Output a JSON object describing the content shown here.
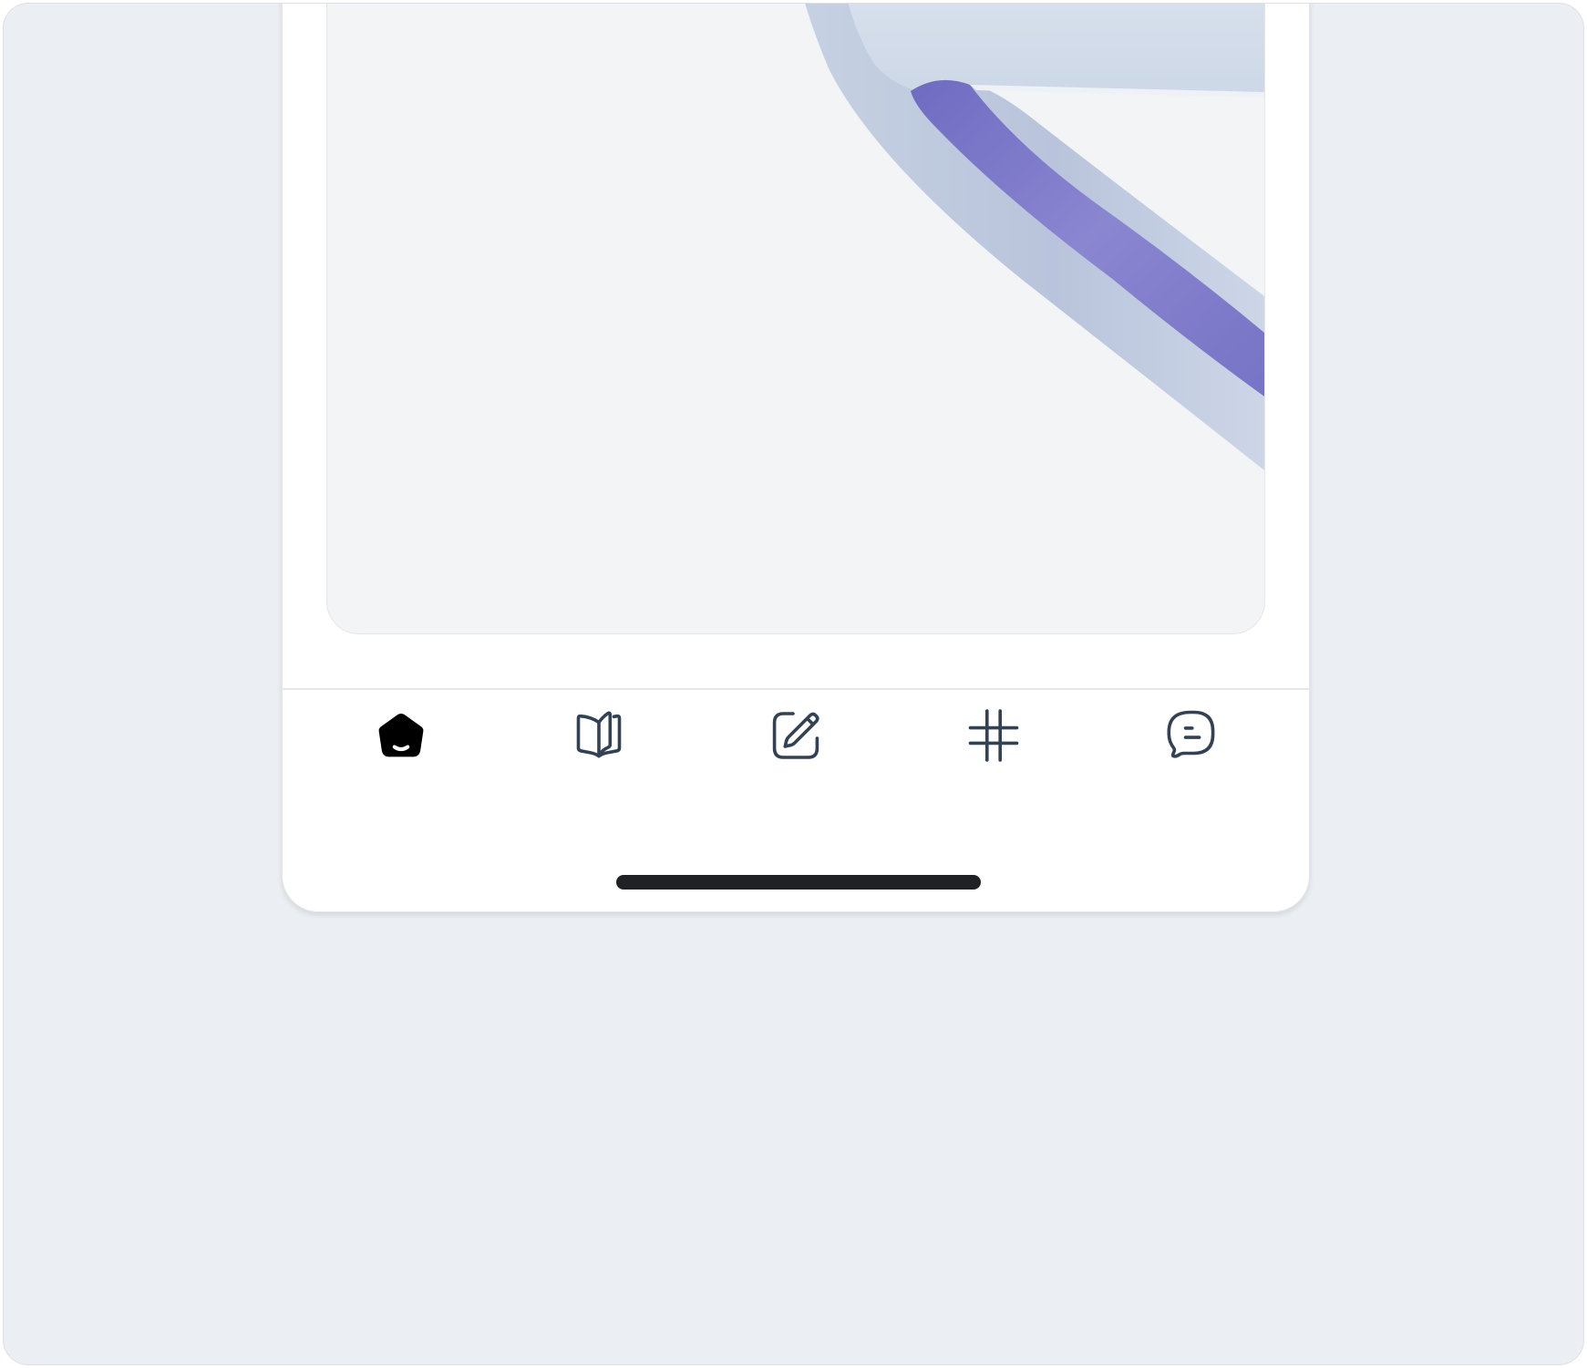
{
  "app": {
    "hero_image": "abstract-3d-ribbon",
    "accent_color": "#7b78c8",
    "icon_color": "#334155"
  },
  "tabbar": {
    "active_tab": "home",
    "tabs": [
      {
        "id": "home",
        "icon": "home-filled-icon",
        "active": true
      },
      {
        "id": "library",
        "icon": "open-book-icon",
        "active": false
      },
      {
        "id": "compose",
        "icon": "edit-square-icon",
        "active": false
      },
      {
        "id": "topics",
        "icon": "hashtag-icon",
        "active": false
      },
      {
        "id": "messages",
        "icon": "chat-bubble-icon",
        "active": false
      }
    ]
  }
}
